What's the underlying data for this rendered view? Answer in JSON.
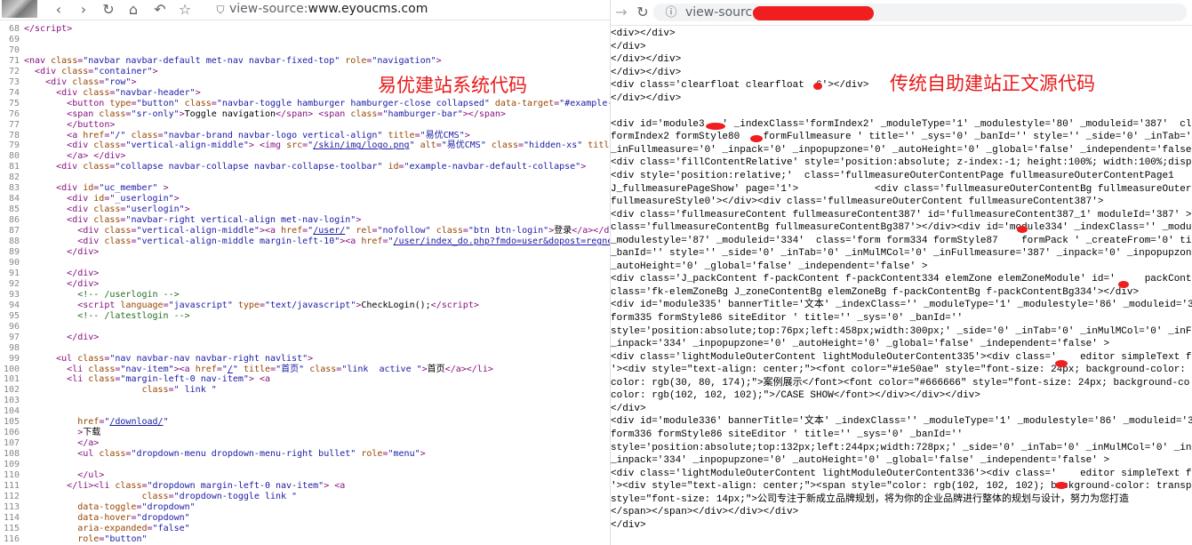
{
  "left": {
    "url_prefix": "view-source:",
    "url_host": "www.eyoucms.com",
    "overlay_label": "易优建站系统代码",
    "lines": [
      {
        "n": "68",
        "html": "<span class='tag'>&lt;/script&gt;</span>"
      },
      {
        "n": "69",
        "html": ""
      },
      {
        "n": "70",
        "html": ""
      },
      {
        "n": "71",
        "html": "<span class='tag'>&lt;nav </span><span class='attr'>class</span><span class='tag'>=</span><span class='val'>\"navbar navbar-default met-nav navbar-fixed-top\"</span> <span class='attr'>role</span><span class='tag'>=</span><span class='val'>\"navigation\"</span><span class='tag'>&gt;</span>"
      },
      {
        "n": "72",
        "html": "  <span class='tag'>&lt;div </span><span class='attr'>class</span><span class='tag'>=</span><span class='val'>\"container\"</span><span class='tag'>&gt;</span>"
      },
      {
        "n": "73",
        "html": "    <span class='tag'>&lt;div </span><span class='attr'>class</span><span class='tag'>=</span><span class='val'>\"row\"</span><span class='tag'>&gt;</span>"
      },
      {
        "n": "74",
        "html": "      <span class='tag'>&lt;div </span><span class='attr'>class</span><span class='tag'>=</span><span class='val'>\"navbar-header\"</span><span class='tag'>&gt;</span>"
      },
      {
        "n": "75",
        "html": "        <span class='tag'>&lt;button </span><span class='attr'>type</span><span class='tag'>=</span><span class='val'>\"button\"</span> <span class='attr'>class</span><span class='tag'>=</span><span class='val'>\"navbar-toggle hamburger hamburger-close collapsed\"</span> <span class='attr'>data-target</span><span class='tag'>=</span><span class='val'>\"#example-navbar</span>"
      },
      {
        "n": "76",
        "html": "        <span class='tag'>&lt;span </span><span class='attr'>class</span><span class='tag'>=</span><span class='val'>\"sr-only\"</span><span class='tag'>&gt;</span>Toggle navigation<span class='tag'>&lt;/span&gt;</span> <span class='tag'>&lt;span </span><span class='attr'>class</span><span class='tag'>=</span><span class='val'>\"hamburger-bar\"</span><span class='tag'>&gt;&lt;/span&gt;</span>"
      },
      {
        "n": "77",
        "html": "        <span class='tag'>&lt;/button&gt;</span>"
      },
      {
        "n": "78",
        "html": "        <span class='tag'>&lt;a </span><span class='attr'>href</span><span class='tag'>=</span><span class='val'>\"/\"</span> <span class='attr'>class</span><span class='tag'>=</span><span class='val'>\"navbar-brand navbar-logo vertical-align\"</span> <span class='attr'>title</span><span class='tag'>=</span><span class='val'>\"易优CMS\"</span><span class='tag'>&gt;</span>"
      },
      {
        "n": "79",
        "html": "        <span class='tag'>&lt;div </span><span class='attr'>class</span><span class='tag'>=</span><span class='val'>\"vertical-align-middle\"</span><span class='tag'>&gt;</span> <span class='tag'>&lt;img </span><span class='attr'>src</span><span class='tag'>=</span><span class='val'>\"</span><span class='lnk'>/skin/img/logo.png</span><span class='val'>\"</span> <span class='attr'>alt</span><span class='tag'>=</span><span class='val'>\"易优CMS\"</span> <span class='attr'>class</span><span class='tag'>=</span><span class='val'>\"hidden-xs\"</span> <span class='attr'>title</span><span class='tag'>=</span><span class='val'>\"易优</span>"
      },
      {
        "n": "80",
        "html": "        <span class='tag'>&lt;/a&gt;</span> <span class='tag'>&lt;/div&gt;</span>"
      },
      {
        "n": "81",
        "html": "      <span class='tag'>&lt;div </span><span class='attr'>class</span><span class='tag'>=</span><span class='val'>\"collapse navbar-collapse navbar-collapse-toolbar\"</span> <span class='attr'>id</span><span class='tag'>=</span><span class='val'>\"example-navbar-default-collapse\"</span><span class='tag'>&gt;</span>"
      },
      {
        "n": "82",
        "html": ""
      },
      {
        "n": "83",
        "html": "      <span class='tag'>&lt;div </span><span class='attr'>id</span><span class='tag'>=</span><span class='val'>\"uc_member\"</span> <span class='tag'>&gt;</span>"
      },
      {
        "n": "84",
        "html": "        <span class='tag'>&lt;div </span><span class='attr'>id</span><span class='tag'>=</span><span class='val'>\"_userlogin\"</span><span class='tag'>&gt;</span>"
      },
      {
        "n": "85",
        "html": "        <span class='tag'>&lt;div </span><span class='attr'>class</span><span class='tag'>=</span><span class='val'>\"userlogin\"</span><span class='tag'>&gt;</span>"
      },
      {
        "n": "86",
        "html": "        <span class='tag'>&lt;div </span><span class='attr'>class</span><span class='tag'>=</span><span class='val'>\"navbar-right vertical-align met-nav-login\"</span><span class='tag'>&gt;</span>"
      },
      {
        "n": "87",
        "html": "          <span class='tag'>&lt;div </span><span class='attr'>class</span><span class='tag'>=</span><span class='val'>\"vertical-align-middle\"</span><span class='tag'>&gt;&lt;a </span><span class='attr'>href</span><span class='tag'>=</span><span class='val'>\"</span><span class='lnk'>/user/</span><span class='val'>\"</span> <span class='attr'>rel</span><span class='tag'>=</span><span class='val'>\"nofollow\"</span> <span class='attr'>class</span><span class='tag'>=</span><span class='val'>\"btn btn-login\"</span><span class='tag'>&gt;</span>登录<span class='tag'>&lt;/a&gt;&lt;/div&gt;</span>"
      },
      {
        "n": "88",
        "html": "          <span class='tag'>&lt;div </span><span class='attr'>class</span><span class='tag'>=</span><span class='val'>\"vertical-align-middle margin-left-10\"</span><span class='tag'>&gt;&lt;a </span><span class='attr'>href</span><span class='tag'>=</span><span class='val'>\"</span><span class='lnk'>/user/index_do.php?fmdo=user&amp;dopost=regnew</span><span class='val'>\"</span> <span class='attr'>rel</span>"
      },
      {
        "n": "89",
        "html": "        <span class='tag'>&lt;/div&gt;</span>"
      },
      {
        "n": "90",
        "html": ""
      },
      {
        "n": "91",
        "html": "        <span class='tag'>&lt;/div&gt;</span>"
      },
      {
        "n": "92",
        "html": "        <span class='tag'>&lt;/div&gt;</span>"
      },
      {
        "n": "93",
        "html": "          <span class='cmt'>&lt;!-- /userlogin --&gt;</span>"
      },
      {
        "n": "94",
        "html": "          <span class='tag'>&lt;script </span><span class='attr'>language</span><span class='tag'>=</span><span class='val'>\"javascript\"</span> <span class='attr'>type</span><span class='tag'>=</span><span class='val'>\"text/javascript\"</span><span class='tag'>&gt;</span>CheckLogin();<span class='tag'>&lt;/script&gt;</span>"
      },
      {
        "n": "95",
        "html": "          <span class='cmt'>&lt;!-- /latestlogin --&gt;</span>"
      },
      {
        "n": "96",
        "html": ""
      },
      {
        "n": "97",
        "html": "        <span class='tag'>&lt;/div&gt;</span>"
      },
      {
        "n": "98",
        "html": ""
      },
      {
        "n": "99",
        "html": "      <span class='tag'>&lt;ul </span><span class='attr'>class</span><span class='tag'>=</span><span class='val'>\"nav navbar-nav navbar-right navlist\"</span><span class='tag'>&gt;</span>"
      },
      {
        "n": "100",
        "html": "        <span class='tag'>&lt;li </span><span class='attr'>class</span><span class='tag'>=</span><span class='val'>\"nav-item\"</span><span class='tag'>&gt;&lt;a </span><span class='attr'>href</span><span class='tag'>=</span><span class='val'>\"</span><span class='lnk'>/</span><span class='val'>\"</span> <span class='attr'>title</span><span class='tag'>=</span><span class='val'>\"首页\"</span> <span class='attr'>class</span><span class='tag'>=</span><span class='val'>\"link  active \"</span><span class='tag'>&gt;</span>首页<span class='tag'>&lt;/a&gt;&lt;/li&gt;</span>"
      },
      {
        "n": "101",
        "html": "        <span class='tag'>&lt;li </span><span class='attr'>class</span><span class='tag'>=</span><span class='val'>\"margin-left-0 nav-item\"</span><span class='tag'>&gt; &lt;a</span>"
      },
      {
        "n": "102",
        "html": "                      <span class='attr'>class</span><span class='tag'>=</span><span class='val'>\" link \"</span>"
      },
      {
        "n": "103",
        "html": ""
      },
      {
        "n": "104",
        "html": ""
      },
      {
        "n": "105",
        "html": "          <span class='attr'>href</span><span class='tag'>=</span><span class='val'>\"</span><span class='lnk'>/download/</span><span class='val'>\"</span>"
      },
      {
        "n": "106",
        "html": "          <span class='tag'>&gt;</span>下载"
      },
      {
        "n": "107",
        "html": "          <span class='tag'>&lt;/a&gt;</span>"
      },
      {
        "n": "108",
        "html": "          <span class='tag'>&lt;ul </span><span class='attr'>class</span><span class='tag'>=</span><span class='val'>\"dropdown-menu dropdown-menu-right bullet\"</span> <span class='attr'>role</span><span class='tag'>=</span><span class='val'>\"menu\"</span><span class='tag'>&gt;</span>"
      },
      {
        "n": "109",
        "html": ""
      },
      {
        "n": "110",
        "html": "          <span class='tag'>&lt;/ul&gt;</span>"
      },
      {
        "n": "111",
        "html": "        <span class='tag'>&lt;/li&gt;&lt;li </span><span class='attr'>class</span><span class='tag'>=</span><span class='val'>\"dropdown margin-left-0 nav-item\"</span><span class='tag'>&gt; &lt;a</span>"
      },
      {
        "n": "112",
        "html": "                      <span class='attr'>class</span><span class='tag'>=</span><span class='val'>\"dropdown-toggle link \"</span>"
      },
      {
        "n": "113",
        "html": "          <span class='attr'>data-toggle</span><span class='tag'>=</span><span class='val'>\"dropdown\"</span>"
      },
      {
        "n": "114",
        "html": "          <span class='attr'>data-hover</span><span class='tag'>=</span><span class='val'>\"dropdown\"</span>"
      },
      {
        "n": "115",
        "html": "          <span class='attr'>aria-expanded</span><span class='tag'>=</span><span class='val'>\"false\"</span>"
      },
      {
        "n": "116",
        "html": "          <span class='attr'>role</span><span class='tag'>=</span><span class='val'>\"button\"</span>"
      }
    ]
  },
  "right": {
    "url_prefix": "view-source",
    "overlay_label": "传统自助建站正文源代码",
    "lines": [
      "<div></div>",
      "</div>",
      "</div></div>",
      "</div></div>",
      "<div class='clearfloat clearfloat  6'></div>",
      "</div></div>",
      "",
      "<div id='module3   ' _indexClass='formIndex2' _moduleType='1' _modulestyle='80' _moduleid='387'  clas",
      "formIndex2 formStyle80    formFullmeasure ' title='' _sys='0' _banId='' style='' _side='0' _inTab='0'",
      "_inFullmeasure='0' _inpack='0' _inpopupzone='0' _autoHeight='0' _global='false' _independent='false'>",
      "<div class='fillContentRelative' style='position:absolute; z-index:-1; height:100%; width:100%;displ",
      "<div style='position:relative;'  class='fullmeasureOuterContentPage fullmeasureOuterContentPage1",
      "J_fullmeasurePageShow' page='1'>             <div class='fullmeasureOuterContentBg fullmeasureOuterCo",
      "fullmeasureStyle0'></div><div class='fullmeasureOuterContent fullmeasureContent387'>",
      "<div class='fullmeasureContent fullmeasureContent387' id='fullmeasureContent387_1' moduleId='387' ><",
      "class='fullmeasureContentBg fullmeasureContentBg387'></div><div id='module334' _indexClass='' _modul",
      "_modulestyle='87' _moduleid='334'  class='form form334 formStyle87    formPack ' _createFrom='0' tit",
      "_banId='' style='' _side='0' _inTab='0' _inMulMCol='0' _inFullmeasure='387' _inpack='0' _inpopupzone",
      "_autoHeight='0' _global='false' _independent='false' >",
      "<div class='J_packContent f-packContent f-packContent334 elemZone elemZoneModule' id='     packContent",
      "class='fk-elemZoneBg J_zoneContentBg elemZoneBg f-packContentBg f-packContentBg334'></div>",
      "<div id='module335' bannerTitle='文本' _indexClass='' _moduleType='1' _modulestyle='86' _moduleid='3",
      "form335 formStyle86 siteEditor ' title='' _sys='0' _banId=''",
      "style='position:absolute;top:76px;left:458px;width:300px;' _side='0' _inTab='0' _inMulMCol='0' _inFu",
      "_inpack='334' _inpopupzone='0' _autoHeight='0' _global='false' _independent='false' >",
      "<div class='lightModuleOuterContent lightModuleOuterContent335'><div class='    editor simpleText fk-",
      "'><div style=\"text-align: center;\"><font color=\"#1e50ae\" style=\"font-size: 24px; background-color: t",
      "color: rgb(30, 80, 174);\">案例展示</font><font color=\"#666666\" style=\"font-size: 24px; background-co",
      "color: rgb(102, 102, 102);\">/CASE SHOW</font></div></div></div>",
      "</div>",
      "<div id='module336' bannerTitle='文本' _indexClass='' _moduleType='1' _modulestyle='86' _moduleid='3",
      "form336 formStyle86 siteEditor ' title='' _sys='0' _banId=''",
      "style='position:absolute;top:132px;left:244px;width:728px;' _side='0' _inTab='0' _inMulMCol='0' _inF",
      "_inpack='334' _inpopupzone='0' _autoHeight='0' _global='false' _independent='false' >",
      "<div class='lightModuleOuterContent lightModuleOuterContent336'><div class='    editor simpleText f",
      "'><div style=\"text-align: center;\"><span style=\"color: rgb(102, 102, 102); background-color: transpa",
      "style=\"font-size: 14px;\">公司专注于新成立品牌规划，将为你的企业品牌进行整体的规划与设计，努力为您打造",
      "</span></span></div></div></div>",
      "</div>"
    ]
  }
}
